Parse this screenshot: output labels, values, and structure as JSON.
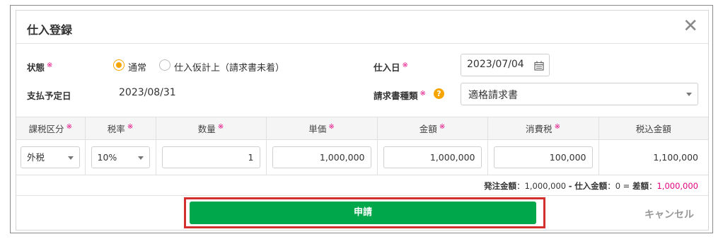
{
  "dialog": {
    "title": "仕入登録",
    "close_glyph": "✕"
  },
  "required_mark": "※",
  "status": {
    "label": "状態",
    "options": [
      {
        "label": "通常",
        "selected": true
      },
      {
        "label": "仕入仮計上（請求書未着）",
        "selected": false
      }
    ]
  },
  "payment_date": {
    "label": "支払予定日",
    "value": "2023/08/31"
  },
  "purchase_date": {
    "label": "仕入日",
    "value": "2023/07/04",
    "icon": "calendar-icon"
  },
  "invoice_type": {
    "label": "請求書種類",
    "help_glyph": "?",
    "value": "適格請求書"
  },
  "table": {
    "headers": [
      "課税区分",
      "税率",
      "数量",
      "単価",
      "金額",
      "消費税",
      "税込金額"
    ],
    "row": {
      "tax_category": "外税",
      "tax_rate": "10%",
      "quantity": "1",
      "unit_price": "1,000,000",
      "amount": "1,000,000",
      "consumption_tax": "100,000",
      "total_with_tax": "1,100,000"
    }
  },
  "summary": {
    "order_label": "発注金額",
    "order_value": "1,000,000",
    "dash": "-",
    "purchase_label": "仕入金額",
    "purchase_value": "0",
    "equals": "=",
    "diff_label": "差額",
    "diff_value": "1,000,000",
    "sep": "："
  },
  "footer": {
    "submit_label": "申請",
    "cancel_label": "キャンセル"
  },
  "colors": {
    "accent_green": "#00a84b",
    "required_pink": "#e4007f",
    "radio_orange": "#f5a400",
    "highlight_red": "#d32f2f"
  }
}
